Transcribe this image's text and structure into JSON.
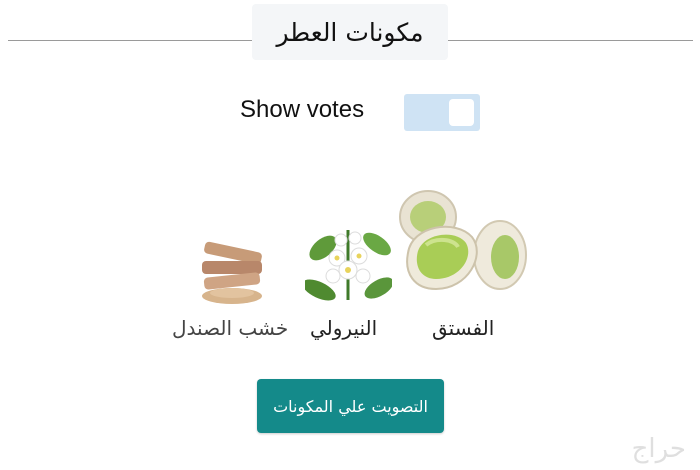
{
  "section": {
    "title": "مكونات العطر"
  },
  "toggle": {
    "label": "Show votes",
    "state": "on"
  },
  "notes": [
    {
      "name": "الفستق",
      "icon": "pistachio-icon"
    },
    {
      "name": "النيرولي",
      "icon": "neroli-flower-icon"
    },
    {
      "name": "خشب الصندل",
      "icon": "sandalwood-icon"
    }
  ],
  "vote_button": {
    "label": "التصويت علي المكونات"
  },
  "watermark": {
    "text": "حراج"
  },
  "colors": {
    "accent": "#148a8a",
    "toggle_on": "#cfe3f4",
    "header_bg": "#f4f6f8"
  }
}
